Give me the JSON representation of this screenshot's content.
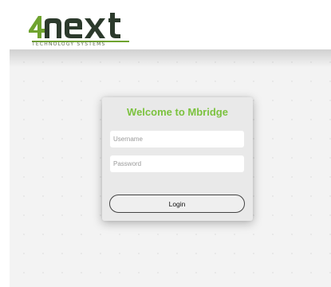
{
  "brand": {
    "logo_text": "4next",
    "tagline": "TECHNOLOGY SYSTEMS",
    "logo_colors": {
      "primary": "#6fa32f",
      "accent": "#2c3a2c"
    }
  },
  "login": {
    "title": "Welcome to Mbridge",
    "username_placeholder": "Username",
    "password_placeholder": "Password",
    "login_label": "Login",
    "title_color": "#7cc23f"
  }
}
